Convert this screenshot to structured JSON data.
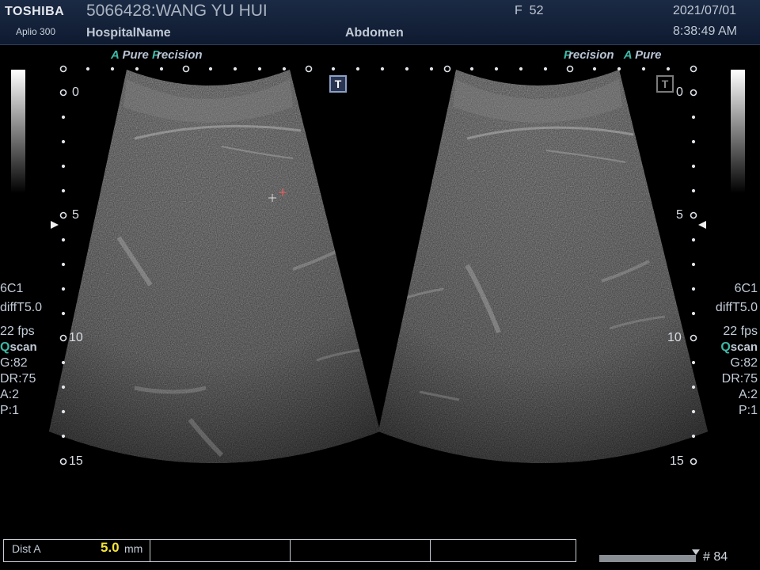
{
  "header": {
    "brand": "TOSHIBA",
    "model": "Aplio 300",
    "patient": "5066428:WANG YU HUI",
    "hospital": "HospitalName",
    "exam": "Abdomen",
    "sex_age": "F  52",
    "date": "2021/07/01",
    "time": "8:38:49 AM"
  },
  "image_labels": {
    "left": {
      "a": "A",
      "pure": "Pure",
      "p": "P",
      "recision": "recision"
    },
    "right": {
      "p": "P",
      "recision": "recision",
      "a": "A",
      "pure": "Pure"
    }
  },
  "params": {
    "probe": "6C1",
    "filter": "diffT5.0",
    "fps": "22 fps",
    "qscan_q": "Q",
    "qscan_rest": "scan",
    "gain": "G:82",
    "dr": "DR:75",
    "a": "A:2",
    "p": "P:1"
  },
  "depth_labels": [
    "0",
    "5",
    "10",
    "15"
  ],
  "t_marker": "T",
  "measurement": {
    "label": "Dist A",
    "value": "5.0",
    "unit": "mm"
  },
  "frame": "# 84",
  "colors": {
    "accent": "#3fb8a6",
    "value": "#f3e33a",
    "header": "#1b2a44"
  }
}
